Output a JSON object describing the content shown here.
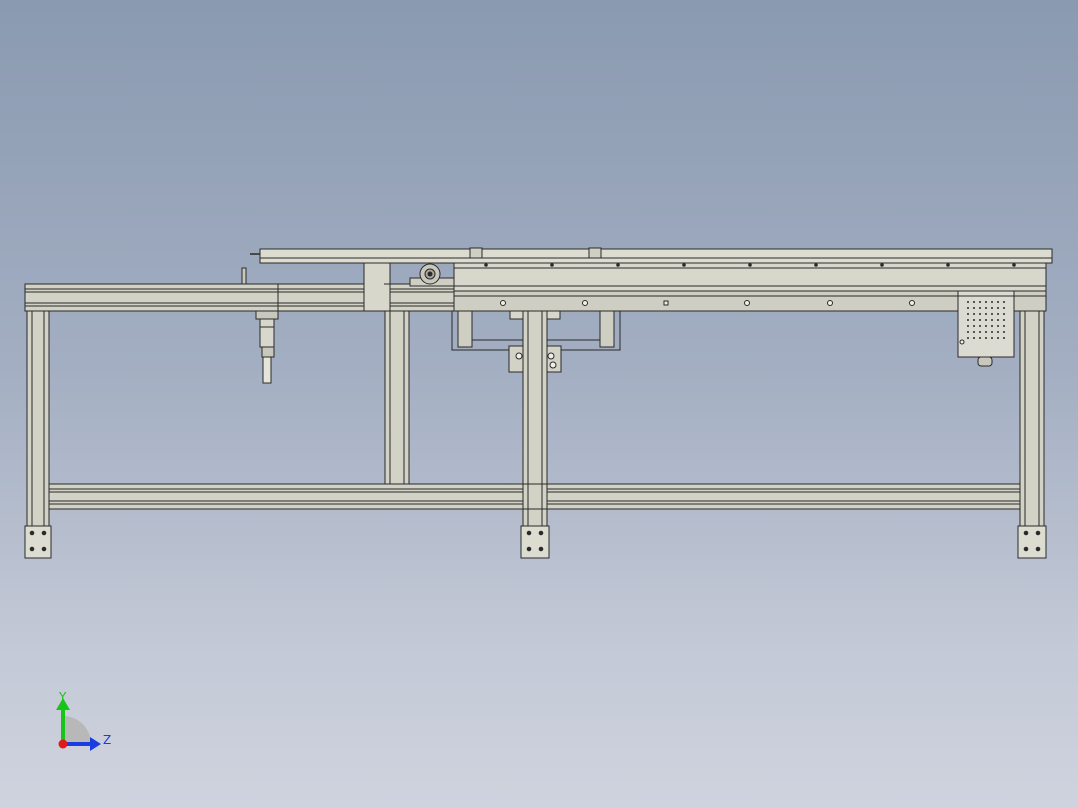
{
  "triad": {
    "y_label": "Y",
    "z_label": "Z",
    "y_color": "#19c419",
    "z_color": "#1a3de0",
    "x_color": "#e01a1a"
  },
  "colors": {
    "metal": "#d3d2c6",
    "metal_light": "#e2e1d7",
    "metal_dark": "#b6b5aa",
    "outline": "#2a2a2a",
    "background_top": "#8a9ab0",
    "background_bottom": "#cfd3de"
  }
}
